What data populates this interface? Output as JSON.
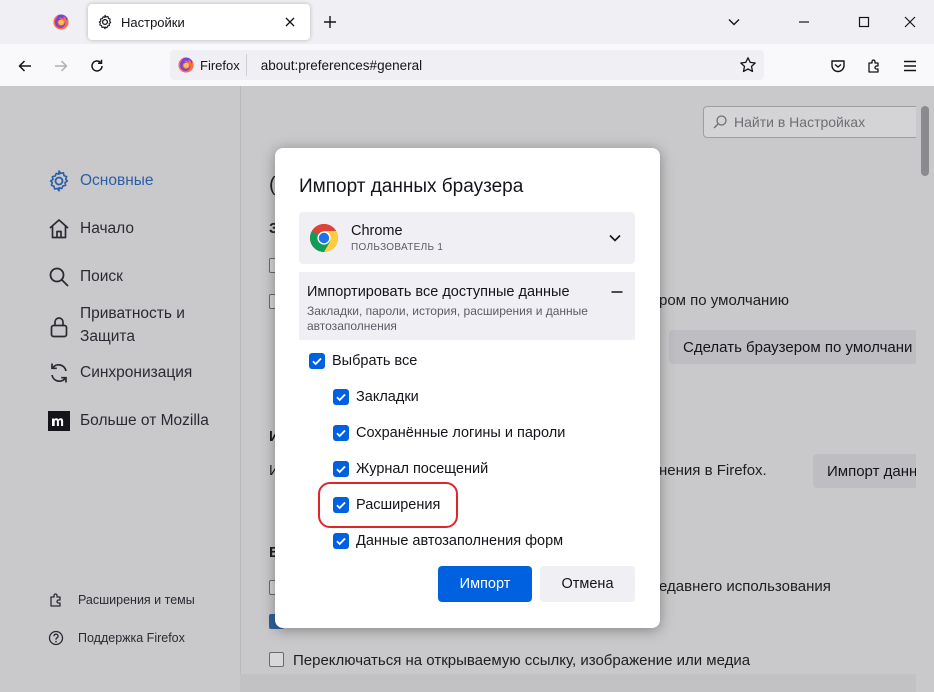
{
  "tabs": {
    "active_title": "Настройки"
  },
  "navbar": {
    "identity_label": "Firefox",
    "url": "about:preferences#general"
  },
  "sidebar": {
    "categories": [
      {
        "label": "Основные",
        "icon": "gear-icon",
        "selected": true
      },
      {
        "label": "Начало",
        "icon": "home-icon"
      },
      {
        "label": "Поиск",
        "icon": "search-icon"
      },
      {
        "label": "Приватность и Защита",
        "icon": "lock-icon"
      },
      {
        "label": "Синхронизация",
        "icon": "sync-icon"
      },
      {
        "label": "Больше от Mozilla",
        "icon": "mozilla-icon"
      }
    ],
    "footer": [
      {
        "label": "Расширения и темы",
        "icon": "puzzle-icon"
      },
      {
        "label": "Поддержка Firefox",
        "icon": "help-icon"
      }
    ]
  },
  "main": {
    "search_placeholder": "Найти в Настройках",
    "bg_default_text": "ром по умолчанию",
    "bg_make_default_button": "Сделать браузером по умолчани",
    "bg_import_text": "нения в Firefox.",
    "bg_import_button": "Импорт данны",
    "bg_recent_text": "едавнего использования",
    "bg_switch_text": "Переключаться на открываемую ссылку, изображение или медиа"
  },
  "dialog": {
    "title": "Импорт данных браузера",
    "browser": {
      "name": "Chrome",
      "profile": "ПОЛЬЗОВАТЕЛЬ 1"
    },
    "import_all": {
      "title": "Импортировать все доступные данные",
      "description": "Закладки, пароли, история, расширения и данные автозаполнения"
    },
    "select_all": "Выбрать все",
    "options": [
      {
        "label": "Закладки",
        "checked": true
      },
      {
        "label": "Сохранённые логины и пароли",
        "checked": true
      },
      {
        "label": "Журнал посещений",
        "checked": true
      },
      {
        "label": "Расширения",
        "checked": true
      },
      {
        "label": "Данные автозаполнения форм",
        "checked": true
      }
    ],
    "import_button": "Импорт",
    "cancel_button": "Отмена"
  },
  "colors": {
    "accent": "#0061e0",
    "highlight": "#e0242b",
    "selected_category": "#2a5ea8"
  }
}
